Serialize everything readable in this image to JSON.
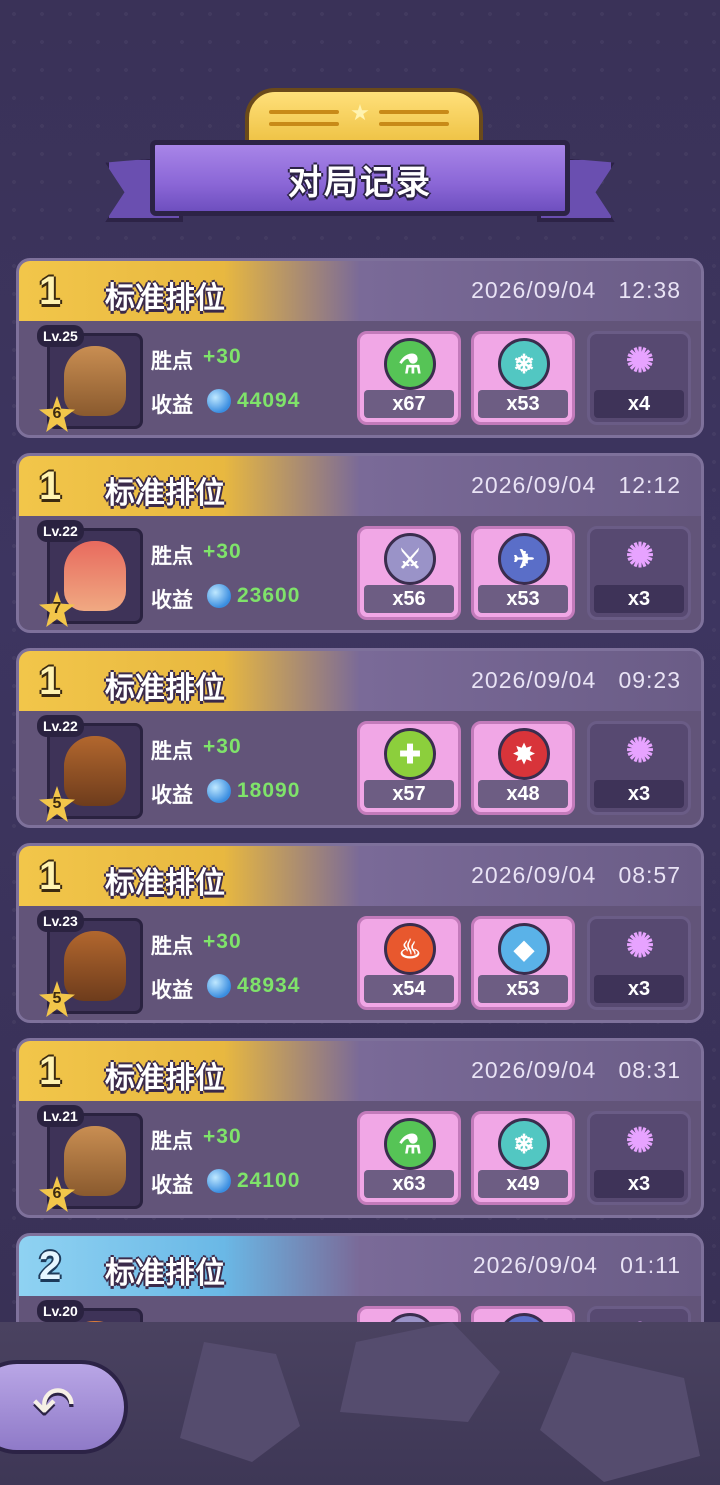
{
  "title": "对局记录",
  "labels": {
    "win_points": "胜点",
    "earnings": "收益"
  },
  "records": [
    {
      "rank": "1",
      "mode": "标准排位",
      "date": "2026/09/04",
      "time": "12:38",
      "level": "Lv.25",
      "stars": "6",
      "win_points": "+30",
      "earnings": "44094",
      "items": [
        {
          "icon": "potion-icon",
          "count": "x67"
        },
        {
          "icon": "snowflake-icon",
          "count": "x53"
        },
        {
          "icon": "spirit-icon",
          "count": "x4"
        }
      ]
    },
    {
      "rank": "1",
      "mode": "标准排位",
      "date": "2026/09/04",
      "time": "12:12",
      "level": "Lv.22",
      "stars": "7",
      "win_points": "+30",
      "earnings": "23600",
      "items": [
        {
          "icon": "sword-icon",
          "count": "x56"
        },
        {
          "icon": "boot-icon",
          "count": "x53"
        },
        {
          "icon": "spirit-icon",
          "count": "x3"
        }
      ]
    },
    {
      "rank": "1",
      "mode": "标准排位",
      "date": "2026/09/04",
      "time": "09:23",
      "level": "Lv.22",
      "stars": "5",
      "win_points": "+30",
      "earnings": "18090",
      "items": [
        {
          "icon": "heal-cross-icon",
          "count": "x57"
        },
        {
          "icon": "burst-icon",
          "count": "x48"
        },
        {
          "icon": "spirit-icon",
          "count": "x3"
        }
      ]
    },
    {
      "rank": "1",
      "mode": "标准排位",
      "date": "2026/09/04",
      "time": "08:57",
      "level": "Lv.23",
      "stars": "5",
      "win_points": "+30",
      "earnings": "48934",
      "items": [
        {
          "icon": "fire-icon",
          "count": "x54"
        },
        {
          "icon": "water-drop-icon",
          "count": "x53"
        },
        {
          "icon": "spirit-icon",
          "count": "x3"
        }
      ]
    },
    {
      "rank": "1",
      "mode": "标准排位",
      "date": "2026/09/04",
      "time": "08:31",
      "level": "Lv.21",
      "stars": "6",
      "win_points": "+30",
      "earnings": "24100",
      "items": [
        {
          "icon": "potion-icon",
          "count": "x63"
        },
        {
          "icon": "snowflake-icon",
          "count": "x49"
        },
        {
          "icon": "spirit-icon",
          "count": "x3"
        }
      ]
    },
    {
      "rank": "2",
      "mode": "标准排位",
      "date": "2026/09/04",
      "time": "01:11",
      "level": "Lv.20"
    }
  ]
}
